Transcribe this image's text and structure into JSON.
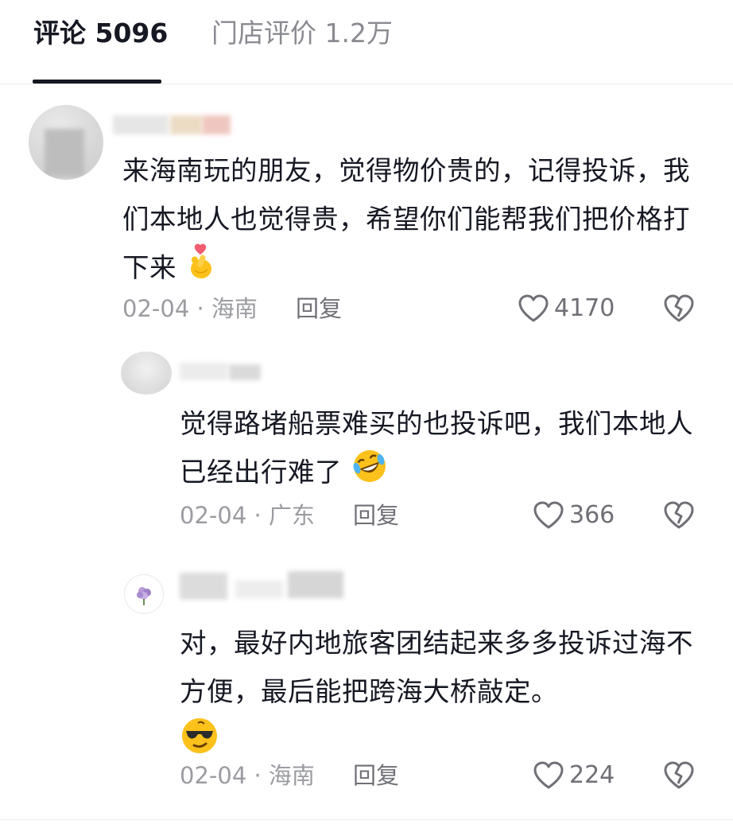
{
  "tabs": {
    "comments_label": "评论 5096",
    "store_reviews_label": "门店评价 1.2万"
  },
  "colors": {
    "text_primary": "#161823",
    "text_secondary": "#9b9ca1",
    "tab_inactive": "#8a8b91",
    "divider": "#ececec"
  },
  "comments": [
    {
      "text": "来海南玩的朋友，觉得物价贵的，记得投诉，我们本地人也觉得贵，希望你们能帮我们把价格打下来",
      "emoji": "finger-heart-emoji",
      "meta": "02-04 · 海南",
      "reply_label": "回复",
      "likes": "4170"
    },
    {
      "text": "觉得路堵船票难买的也投诉吧，我们本地人已经出行难了",
      "emoji": "rofl-emoji",
      "meta": "02-04 · 广东",
      "reply_label": "回复",
      "likes": "366"
    },
    {
      "text": "对，最好内地旅客团结起来多多投诉过海不方便，最后能把跨海大桥敲定。",
      "emoji": "sunglasses-emoji",
      "meta": "02-04 · 海南",
      "reply_label": "回复",
      "likes": "224"
    }
  ]
}
